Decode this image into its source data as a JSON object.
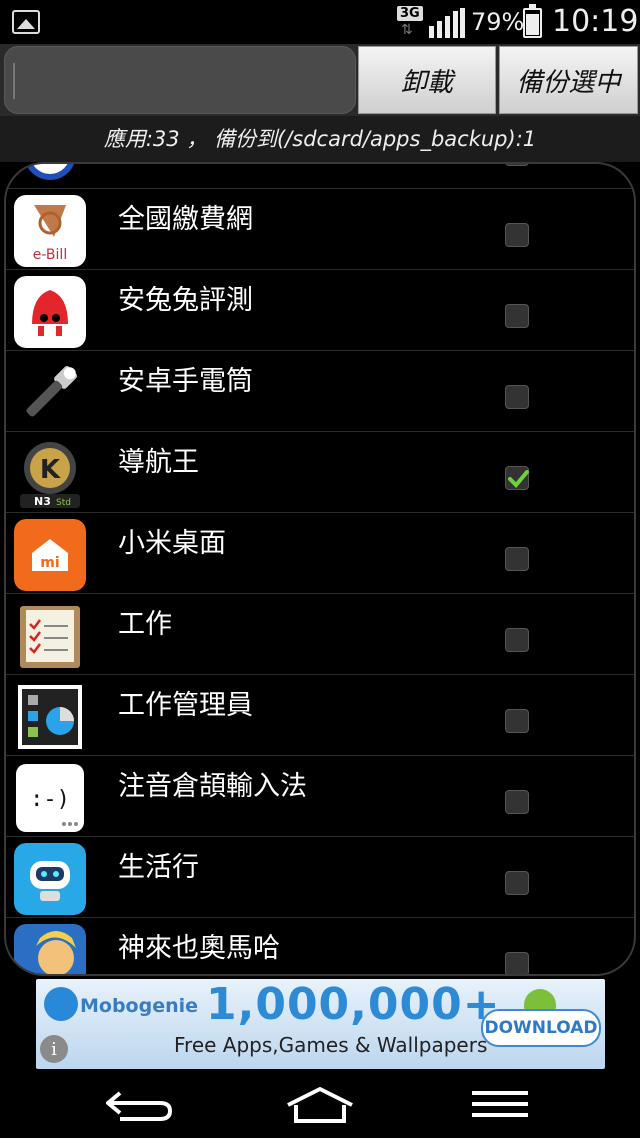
{
  "status_bar": {
    "network": "3G",
    "battery_percent": "79%",
    "battery_level": 0.79,
    "time": "10:19"
  },
  "toolbar": {
    "search_value": "",
    "uninstall_label": "卸載",
    "backup_label": "備份選中"
  },
  "info_bar": {
    "text": "應用:33 ， 備份到(/sdcard/apps_backup):1"
  },
  "apps": [
    {
      "name": "",
      "icon": "alarm-clock-icon",
      "checked": false
    },
    {
      "name": "全國繳費網",
      "icon": "ebill-icon",
      "checked": false
    },
    {
      "name": "安兔兔評測",
      "icon": "antutu-icon",
      "checked": false
    },
    {
      "name": "安卓手電筒",
      "icon": "flashlight-icon",
      "checked": false
    },
    {
      "name": "導航王",
      "icon": "navking-icon",
      "checked": true
    },
    {
      "name": "小米桌面",
      "icon": "mi-home-icon",
      "checked": false
    },
    {
      "name": "工作",
      "icon": "checklist-icon",
      "checked": false
    },
    {
      "name": "工作管理員",
      "icon": "task-manager-icon",
      "checked": false
    },
    {
      "name": "注音倉頡輸入法",
      "icon": "keyboard-smile-icon",
      "checked": false
    },
    {
      "name": "生活行",
      "icon": "robot-icon",
      "checked": false
    },
    {
      "name": "神來也奧馬哈",
      "icon": "game-avatar-icon",
      "checked": false
    }
  ],
  "ad": {
    "brand": "Mobogenie",
    "count": "1,000,000+",
    "subtitle": "Free Apps,Games & Wallpapers",
    "cta": "DOWNLOAD",
    "info": "i"
  },
  "colors": {
    "accent_check": "#6fd23a",
    "background": "#000000",
    "ad_blue": "#2d8bd6"
  }
}
